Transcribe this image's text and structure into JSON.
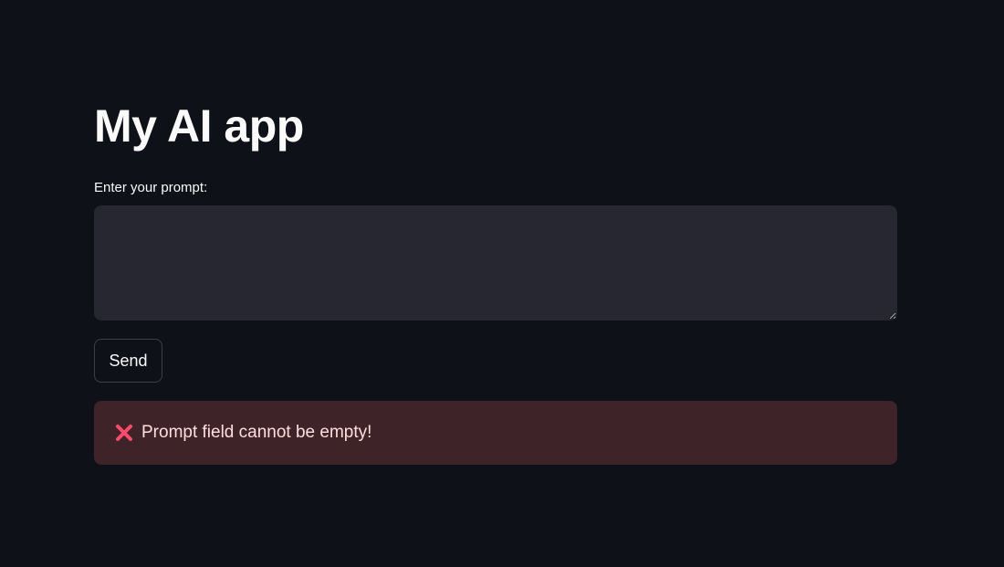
{
  "app": {
    "title": "My AI app"
  },
  "form": {
    "prompt_label": "Enter your prompt:",
    "prompt_value": "",
    "send_label": "Send"
  },
  "alert": {
    "icon": "cross-mark-icon",
    "message": "Prompt field cannot be empty!",
    "type": "error"
  },
  "colors": {
    "background": "#0e1117",
    "input_background": "#262730",
    "error_background": "#3e2428",
    "error_text": "#ffdede",
    "error_icon": "#ff4b6e"
  }
}
